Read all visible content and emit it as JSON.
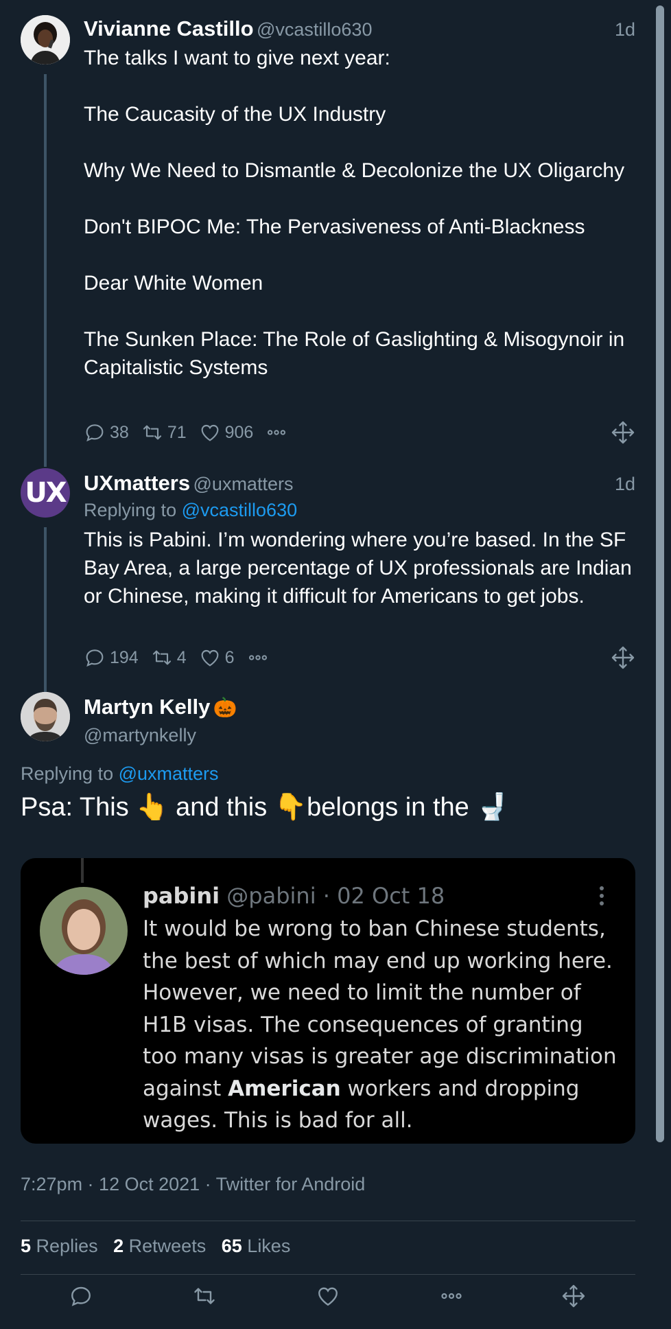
{
  "tweet1": {
    "name": "Vivianne Castillo",
    "handle": "@vcastillo630",
    "time": "1d",
    "text": "The talks I want to give next year:\n\nThe Caucasity of the UX Industry\n\nWhy We Need to Dismantle & Decolonize the UX Oligarchy\n\nDon't BIPOC Me: The Pervasiveness of Anti-Blackness\n\nDear White Women\n\nThe Sunken Place: The Role of Gaslighting & Misogynoir in Capitalistic Systems",
    "replies": "38",
    "retweets": "71",
    "likes": "906"
  },
  "tweet2": {
    "avatar_text": "UX",
    "name": "UXmatters",
    "handle": "@uxmatters",
    "time": "1d",
    "replying_label": "Replying to",
    "replying_handle": "@vcastillo630",
    "text": "This is Pabini. I’m wondering where you’re based. In the SF Bay Area, a large percentage of UX professionals are Indian or Chinese, making it difficult for Americans to get jobs.",
    "replies": "194",
    "retweets": "4",
    "likes": "6"
  },
  "main_tweet": {
    "name": "Martyn Kelly",
    "name_emoji": "🎃",
    "handle": "@martynkelly",
    "replying_label": "Replying to",
    "replying_handle": "@uxmatters",
    "text_part1": "Psa: This",
    "emoji_up": "👆",
    "text_part2": "and this",
    "emoji_down": "👇",
    "text_part3": "belongs in the",
    "emoji_toilet": "🚽",
    "embed": {
      "name": "pabini",
      "handle_date": "@pabini · 02 Oct 18",
      "text_before_bold": "It would be wrong to ban Chinese students, the best of which may end up working here. However, we need to limit the number of H1B visas. The consequences of granting too many visas is greater age discrimination against ",
      "bold_word": "American",
      "text_after_bold": " workers and dropping wages. This is bad for all."
    },
    "meta": "7:27pm · 12 Oct 2021 · Twitter for Android",
    "stats": {
      "replies_count": "5",
      "replies_label": "Replies",
      "retweets_count": "2",
      "retweets_label": "Retweets",
      "likes_count": "65",
      "likes_label": "Likes"
    }
  },
  "colors": {
    "background": "#15202b",
    "secondary_text": "#8899a6",
    "link": "#1d9bf0",
    "uxmatters_avatar": "#5b3a88"
  },
  "icons": [
    "reply-icon",
    "retweet-icon",
    "like-icon",
    "more-icon",
    "move-icon"
  ]
}
